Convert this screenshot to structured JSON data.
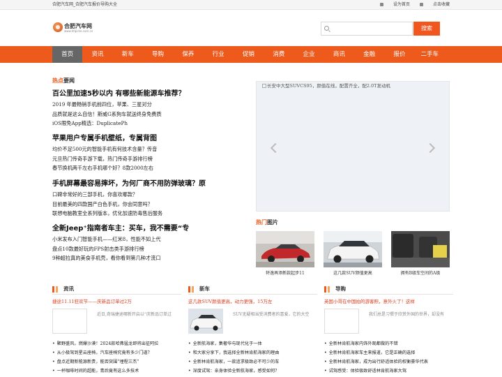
{
  "topbar": {
    "left_text": "合肥汽车网_合肥汽车报价导购大全",
    "set_home": "设为首页",
    "bookmark": "点击收藏"
  },
  "logo": {
    "name": "合肥汽车网",
    "sub": "www.hfqiche.com.cn"
  },
  "search": {
    "placeholder": "",
    "value": "",
    "button": "搜索"
  },
  "nav": {
    "items": [
      "首页",
      "资讯",
      "新车",
      "导购",
      "保养",
      "行业",
      "促销",
      "消费",
      "企业",
      "商讯",
      "金融",
      "报价",
      "二手车"
    ],
    "active": "首页"
  },
  "hot_news": {
    "title_hl": "热点",
    "title_rest": "要闻",
    "blocks": [
      {
        "headline": "百公里加速5秒以内 有哪些新能源车推荐？",
        "items": [
          "2019 年最畅销手机前四位，苹果、三星对分",
          "品质就是这么自信！斯威G系狗车就送终身免费质",
          "iOS限免App精选：DuplicatePh"
        ]
      },
      {
        "headline": "苹果用户专属手机壁纸，专属背图",
        "items": [
          "均价不足500元的智能手机有何技术含量？传音",
          "元旦热门传奇手游下载，热门传奇手游排行榜",
          "春节换机两千左右手机哪个好？8款2000左右"
        ]
      },
      {
        "headline": "手机屏幕最容易摔坏，为何厂商不用防弹玻璃？原",
        "items": [
          "口碑非常好的三部手机，你喜欢哪款？",
          "目前最美的四款国产白色手机，你会同意吗？",
          "联想电脑教室全系列版本，优化加速防毒售后服务"
        ]
      },
      {
        "headline": "全新Jeep⁺指南者车主：买车，我不需要“专",
        "items": [
          "小米发布入门智能手机——红米8，性能不如上代",
          "盘点10款最好玩的FPS射击类手游排行榜",
          "9种超拉真的美食手机壳，看你看到第几种才流口"
        ]
      }
    ]
  },
  "slider": {
    "caption": "长安中大型SUVCS95，颜值在线，配置齐全，配2.0T发动机"
  },
  "hot_pics": {
    "title_hl": "热门",
    "title_rest": "图片",
    "items": [
      {
        "caption": "轩逸再添新款起步11"
      },
      {
        "caption": "这几款SUV颜值更高"
      },
      {
        "caption": "拥有B级车空间的A级"
      }
    ]
  },
  "columns": [
    {
      "title": "资讯",
      "hot": "捷途11.11狂欢节——庆新品订单过2万",
      "desc": "近日,奇瑞捷途哪新开启以“庆新品订单过",
      "items": [
        "聚野盛风，燃爆沙漠！2024款哈弗猛龙即将出征阿拉",
        "从小极驾到星云座椅，汽车座椅究竟有多少门道？",
        "盘点近期新能源新贵，能否突围“埋程三杰”",
        "一杯咖啡时间的超能，青后竟有这么多技术"
      ]
    },
    {
      "title": "新车",
      "hot": "这几款SUV颜值更高，动力更强，15万左",
      "desc": "SUV无疑相当受消费者的喜爱，它的大空",
      "items": [
        "全新航海家，集奢华与现代化于一体",
        "和大家分享下，我选择全新林肯航海家的理由",
        "全新林肯航海家，一款追求极致必不可少的车",
        "深度试驾：亲身体验全新航海家，感受如何？"
      ]
    },
    {
      "title": "导购",
      "hot": "英国小哥在中国拍的游客照，意外火了！这样",
      "desc": "我们总是习惯于欣赏外国的世界，却没有",
      "items": [
        "全新林肯航海家内饰外观都做的不错",
        "全新林肯航海家车主来报道，它是正确的选择",
        "全新林肯航海家，成为出行舒适体验的权衡豪华代表",
        "试驾感受：体验极致舒适林肯航海家大驾"
      ]
    }
  ]
}
